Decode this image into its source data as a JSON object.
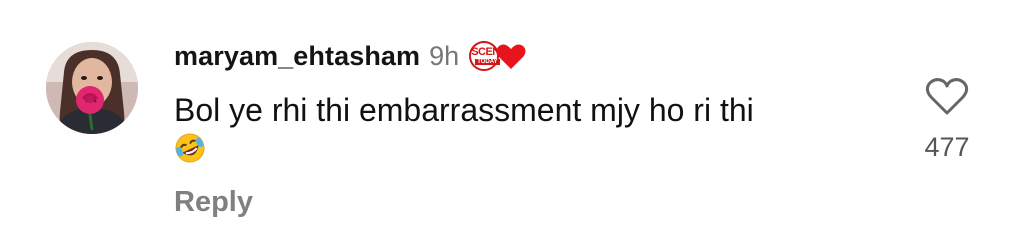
{
  "comment": {
    "username": "maryam_ehtasham",
    "time": "9h",
    "badge": {
      "text": "SCEN",
      "subtext": "TODAY",
      "color": "#d41616"
    },
    "text": "Bol ye rhi thi embarrassment mjy ho ri thi",
    "emoji": "rolling-on-the-floor-laughing",
    "reply_label": "Reply",
    "like_icon": "heart-outline-icon",
    "like_count": "477"
  }
}
